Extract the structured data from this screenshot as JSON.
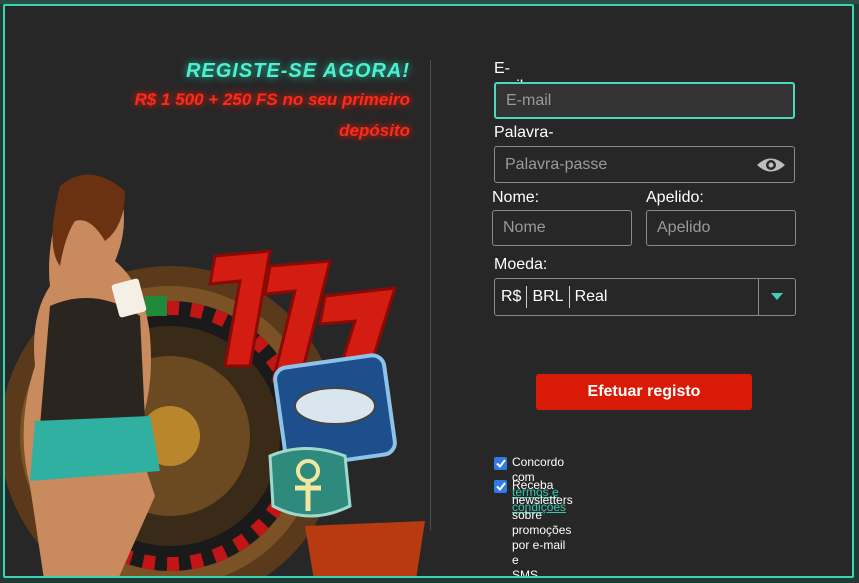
{
  "promo": {
    "headline": "REGISTE-SE AGORA!",
    "offer_line1": "R$ 1 500 + 250 FS no seu primeiro",
    "offer_line2": "depósito"
  },
  "form": {
    "email_label": "E-mail:",
    "email_placeholder": "E-mail",
    "password_label": "Palavra-passe:",
    "password_placeholder": "Palavra-passe",
    "first_name_label": "Nome:",
    "first_name_placeholder": "Nome",
    "last_name_label": "Apelido:",
    "last_name_placeholder": "Apelido",
    "currency_label": "Moeda:",
    "currency": {
      "symbol": "R$",
      "code": "BRL",
      "name": "Real"
    },
    "submit_label": "Efetuar registo",
    "terms_prefix": "Concordo com ",
    "terms_link": "termos e condições",
    "newsletter_line1": "Receba newsletters sobre promoções por e-mail e",
    "newsletter_line2": "SMS"
  },
  "colors": {
    "accent": "#3fd1b3",
    "submit": "#d91a07",
    "headline": "#4ff0cf",
    "offer": "#ff2a1a",
    "checkbox": "#2f7be8"
  },
  "icons": [
    "eye-icon",
    "chevron-down-icon",
    "checkmark-icon"
  ]
}
